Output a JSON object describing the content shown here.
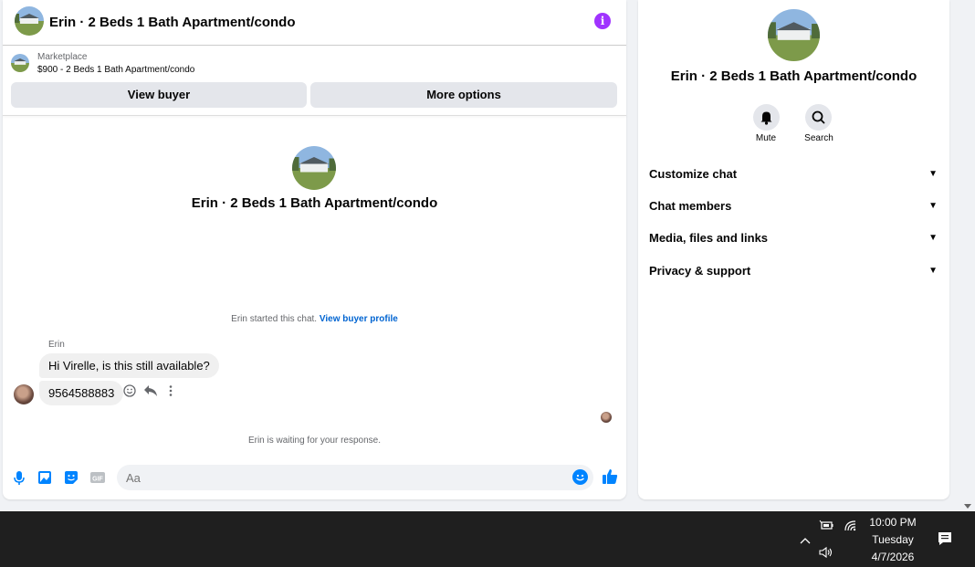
{
  "chat": {
    "header_title": "Erin · 2 Beds 1 Bath Apartment/condo",
    "info_label": "i",
    "marketplace_label": "Marketplace",
    "listing_text": "$900 - 2 Beds 1 Bath Apartment/condo",
    "view_buyer_label": "View buyer",
    "more_options_label": "More options",
    "center_title": "Erin · 2 Beds 1 Bath Apartment/condo",
    "started_text": "Erin started this chat.",
    "started_link": "View buyer profile",
    "sender_name": "Erin",
    "messages": [
      {
        "text": "Hi Virelle, is this still available?"
      },
      {
        "text": "9564588883"
      }
    ],
    "waiting_text": "Erin is waiting for your response.",
    "composer_placeholder": "Aa",
    "composer_icons": [
      "microphone-icon",
      "photo-icon",
      "sticker-icon",
      "gif-icon"
    ],
    "accent_color": "#0084ff"
  },
  "details": {
    "title": "Erin · 2 Beds 1 Bath Apartment/condo",
    "actions": [
      {
        "label": "Mute",
        "icon": "bell-icon"
      },
      {
        "label": "Search",
        "icon": "search-icon"
      }
    ],
    "sections": [
      {
        "label": "Customize chat"
      },
      {
        "label": "Chat members"
      },
      {
        "label": "Media, files and links"
      },
      {
        "label": "Privacy & support"
      }
    ]
  },
  "taskbar": {
    "time": "10:00 PM",
    "day": "Tuesday",
    "date": "4/7/2026"
  }
}
